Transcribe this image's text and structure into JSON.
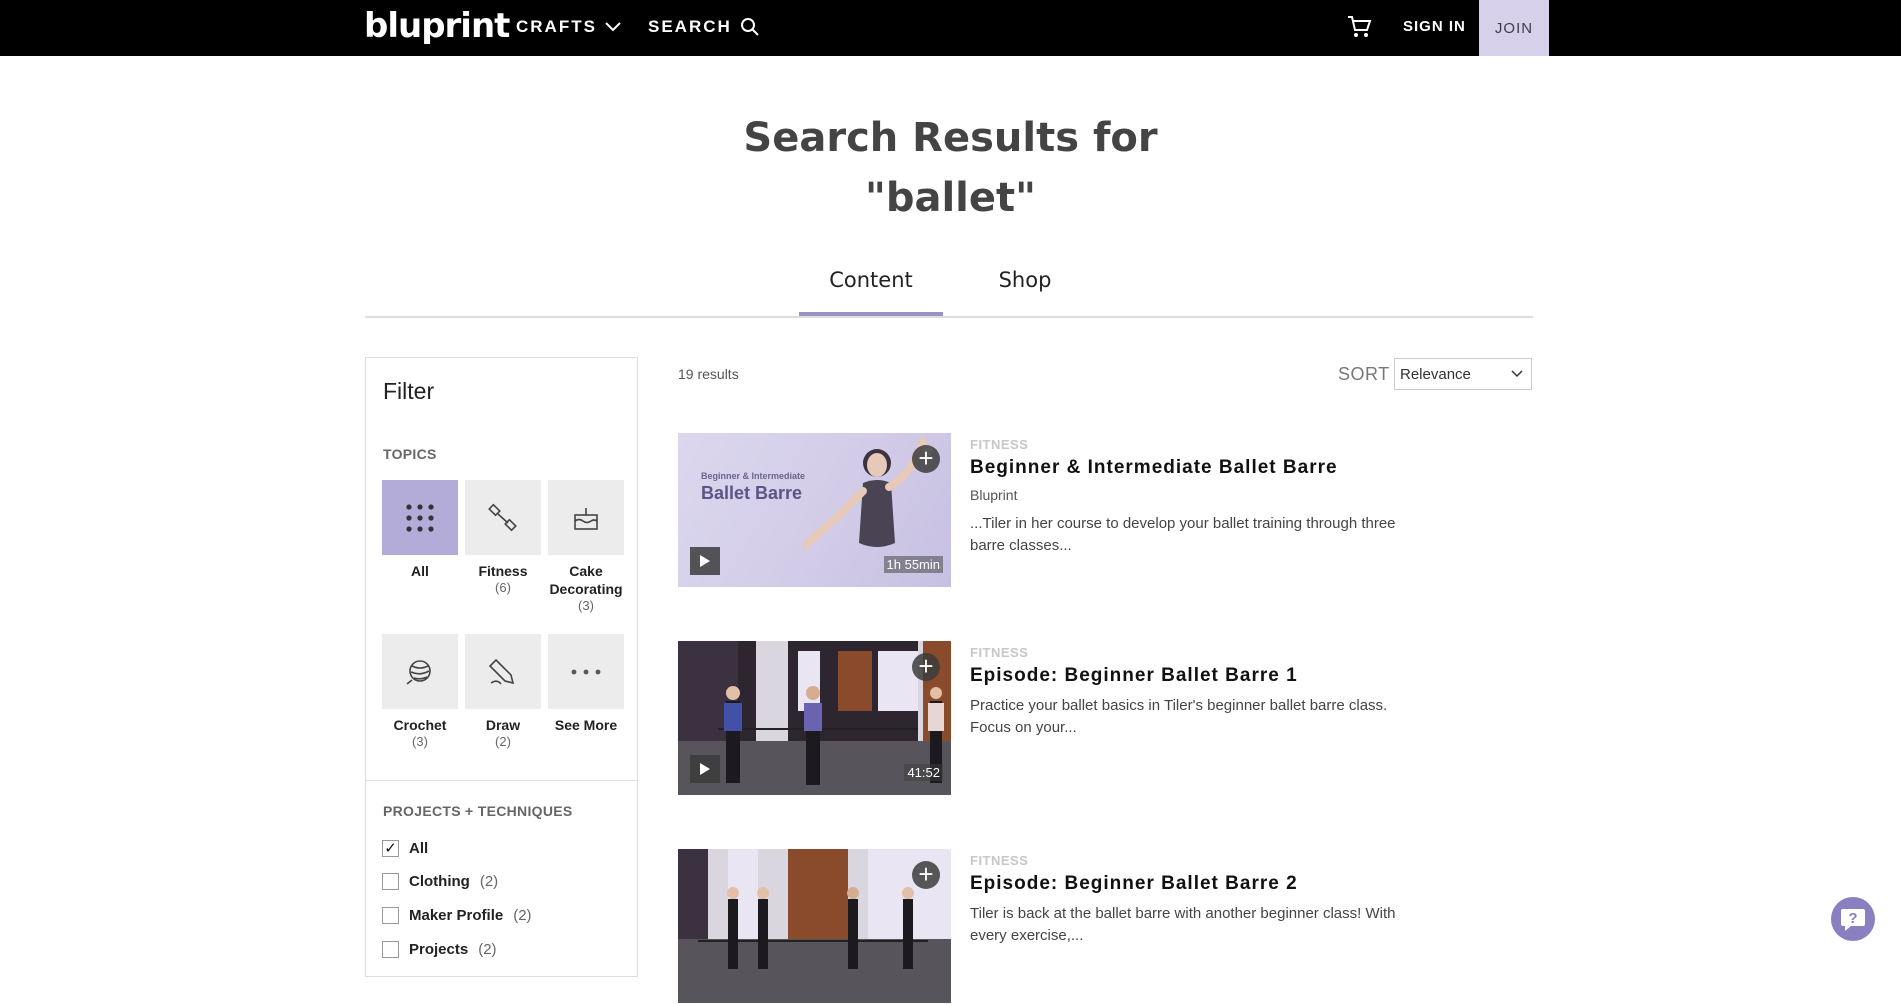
{
  "header": {
    "logo": "bluprint",
    "crafts_label": "CRAFTS",
    "search_label": "SEARCH",
    "signin_label": "SIGN IN",
    "join_label": "JOIN"
  },
  "page": {
    "heading_line1": "Search Results for",
    "heading_line2": "\"ballet\""
  },
  "tabs": [
    {
      "label": "Content",
      "active": true
    },
    {
      "label": "Shop",
      "active": false
    }
  ],
  "filter": {
    "title": "Filter",
    "topics_label": "TOPICS",
    "topics": [
      {
        "name": "All",
        "count": "",
        "icon": "grid-icon",
        "active": true
      },
      {
        "name": "Fitness",
        "count": "(6)",
        "icon": "dumbbell-icon"
      },
      {
        "name": "Cake Decorating",
        "count": "(3)",
        "icon": "cake-icon"
      },
      {
        "name": "Crochet",
        "count": "(3)",
        "icon": "yarn-ball-icon"
      },
      {
        "name": "Draw",
        "count": "(2)",
        "icon": "pencil-icon"
      },
      {
        "name": "See More",
        "count": "",
        "icon": "more-dots-icon"
      }
    ],
    "projects_label": "PROJECTS + TECHNIQUES",
    "projects": [
      {
        "label": "All",
        "count": "",
        "checked": true
      },
      {
        "label": "Clothing",
        "count": "(2)",
        "checked": false
      },
      {
        "label": "Maker Profile",
        "count": "(2)",
        "checked": false
      },
      {
        "label": "Projects",
        "count": "(2)",
        "checked": false
      }
    ]
  },
  "results": {
    "count_text": "19 results",
    "sort_label": "SORT",
    "sort_value": "Relevance",
    "items": [
      {
        "category": "FITNESS",
        "title": "Beginner & Intermediate Ballet Barre",
        "author": "Bluprint",
        "description": "...Tiler in her course to develop your ballet training through three barre classes...",
        "duration": "1h 55min",
        "thumb_small": "Beginner & Intermediate",
        "thumb_big": "Ballet Barre"
      },
      {
        "category": "FITNESS",
        "title": "Episode: Beginner Ballet Barre 1",
        "author": "",
        "description": "Practice your ballet basics in Tiler's beginner ballet barre class. Focus on your...",
        "duration": "41:52"
      },
      {
        "category": "FITNESS",
        "title": "Episode: Beginner Ballet Barre 2",
        "author": "",
        "description": "Tiler is back at the ballet barre with another beginner class! With every exercise,...",
        "duration": ""
      }
    ]
  },
  "colors": {
    "accent": "#9b91c6",
    "active_topic": "#b3abd8",
    "join_bg": "#d6d0ea",
    "header_bg": "#000000"
  }
}
